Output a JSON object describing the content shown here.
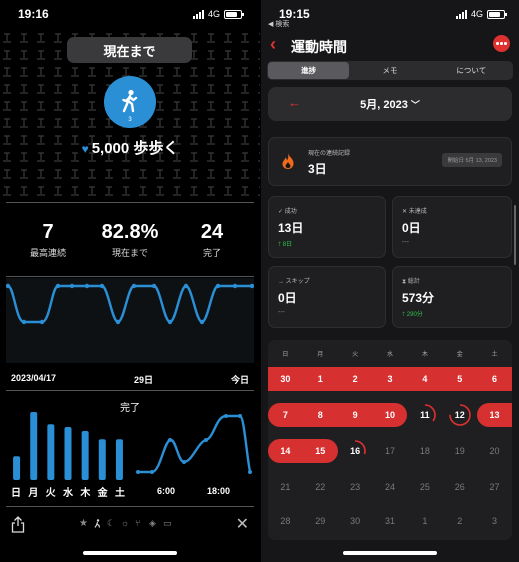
{
  "left": {
    "status": {
      "time": "19:16",
      "network": "4G"
    },
    "now_button": "現在まで",
    "badge_number": "3",
    "goal_text": "5,000 歩歩く",
    "stats": [
      {
        "value": "7",
        "label": "最高連続"
      },
      {
        "value": "82.8%",
        "label": "現在まで"
      },
      {
        "value": "24",
        "label": "完了"
      }
    ],
    "date_axis": {
      "start": "2023/04/17",
      "mid": "29日",
      "end": "今日"
    },
    "done_title": "完了",
    "weekdays": [
      "日",
      "月",
      "火",
      "水",
      "木",
      "金",
      "土"
    ],
    "weekday_values": [
      0.35,
      1.0,
      0.82,
      0.78,
      0.72,
      0.6,
      0.6
    ],
    "hour_labels": [
      "6:00",
      "18:00"
    ],
    "accent": "#2b8fd6",
    "icons": [
      "share-icon",
      "star-icon",
      "walker-icon",
      "moon-icon",
      "sun-icon",
      "chair-icon",
      "tag-icon",
      "tv-icon",
      "close-icon"
    ]
  },
  "right": {
    "status": {
      "time": "19:15",
      "network": "4G",
      "back_app": "◀ 検索"
    },
    "title": "運動時間",
    "segments": [
      "進捗",
      "メモ",
      "について"
    ],
    "month": "5月, 2023",
    "streak": {
      "label": "現在の連続記録",
      "value": "3日",
      "since": "開始日 5月 13, 2023"
    },
    "cards": [
      {
        "icon": "✓",
        "label": "成功",
        "value": "13日",
        "sub": "8日",
        "sub_type": "up"
      },
      {
        "icon": "✕",
        "label": "未達成",
        "value": "0日",
        "sub": "---",
        "sub_type": "dash"
      },
      {
        "icon": "→",
        "label": "スキップ",
        "value": "0日",
        "sub": "---",
        "sub_type": "dash"
      },
      {
        "icon": "⧗",
        "label": "総計",
        "value": "573分",
        "sub": "290分",
        "sub_type": "up"
      }
    ],
    "weekday_header": [
      "日",
      "月",
      "火",
      "水",
      "木",
      "金",
      "土"
    ],
    "calendar": [
      [
        "30",
        "1",
        "2",
        "3",
        "4",
        "5",
        "6"
      ],
      [
        "7",
        "8",
        "9",
        "10",
        "11",
        "12",
        "13"
      ],
      [
        "14",
        "15",
        "16",
        "17",
        "18",
        "19",
        "20"
      ],
      [
        "21",
        "22",
        "23",
        "24",
        "25",
        "26",
        "27"
      ],
      [
        "28",
        "29",
        "30",
        "31",
        "1",
        "2",
        "3"
      ]
    ],
    "accent": "#e03131",
    "success_color": "#30c24b"
  }
}
